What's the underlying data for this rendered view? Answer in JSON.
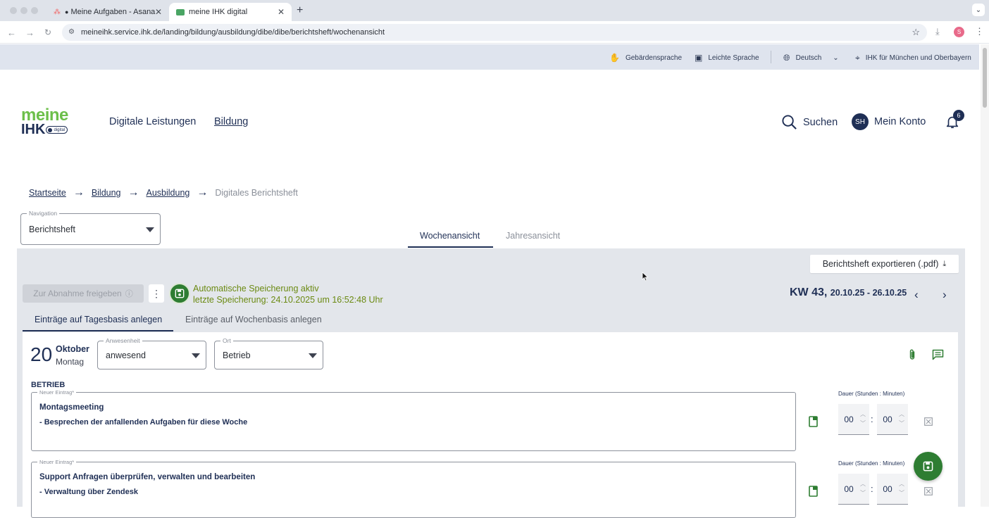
{
  "browser": {
    "tabs": [
      {
        "label": "Meine Aufgaben - Asana",
        "active": false
      },
      {
        "label": "meine IHK digital",
        "active": true
      }
    ],
    "new_tab": "+",
    "url": "meineihk.service.ihk.de/landing/bildung/ausbildung/dibe/dibe/berichtsheft/wochenansicht",
    "profile_initial": "S"
  },
  "utility_bar": {
    "sign_language": "Gebärdensprache",
    "easy_language": "Leichte Sprache",
    "language": "Deutsch",
    "chamber": "IHK für München und Oberbayern"
  },
  "header": {
    "logo_top": "meine",
    "logo_bottom": "IHK",
    "logo_badge": "digital",
    "nav": [
      "Digitale Leistungen",
      "Bildung"
    ],
    "search_label": "Suchen",
    "account_initials": "SH",
    "account_label": "Mein Konto",
    "notification_count": "6"
  },
  "breadcrumb": [
    "Startseite",
    "Bildung",
    "Ausbildung",
    "Digitales Berichtsheft"
  ],
  "navigation_select": {
    "legend": "Navigation",
    "value": "Berichtsheft"
  },
  "view_tabs": [
    "Wochenansicht",
    "Jahresansicht"
  ],
  "toolbar": {
    "export_label": "Berichtsheft exportieren (.pdf)",
    "release_label": "Zur Abnahme freigeben",
    "autosave_line1": "Automatische Speicherung aktiv",
    "autosave_line2": "letzte Speicherung: 24.10.2025 um 16:52:48 Uhr",
    "kw_label": "KW 43,",
    "kw_range": "20.10.25 - 26.10.25"
  },
  "entry_tabs": [
    "Einträge auf Tagesbasis anlegen",
    "Einträge auf Wochenbasis anlegen"
  ],
  "day": {
    "number": "20",
    "month": "Oktober",
    "weekday": "Montag",
    "attendance": {
      "legend": "Anwesenheit",
      "value": "anwesend"
    },
    "location": {
      "legend": "Ort",
      "value": "Betrieb"
    },
    "section": "BETRIEB",
    "duration_label": "Dauer (Stunden : Minuten)",
    "entries": [
      {
        "legend": "Neuer Eintrag*",
        "title": "Montagsmeeting",
        "detail": "- Besprechen der anfallenden Aufgaben für diese Woche",
        "hours": "00",
        "minutes": "00"
      },
      {
        "legend": "Neuer Eintrag*",
        "title": "Support Anfragen überprüfen, verwalten und bearbeiten",
        "detail": "- Verwaltung über Zendesk",
        "hours": "00",
        "minutes": "00"
      }
    ]
  },
  "colors": {
    "brand_green": "#2e7d32",
    "navy": "#1f2f55",
    "panel_gray": "#e3e6eb",
    "autosave_text": "#6b8a12"
  }
}
